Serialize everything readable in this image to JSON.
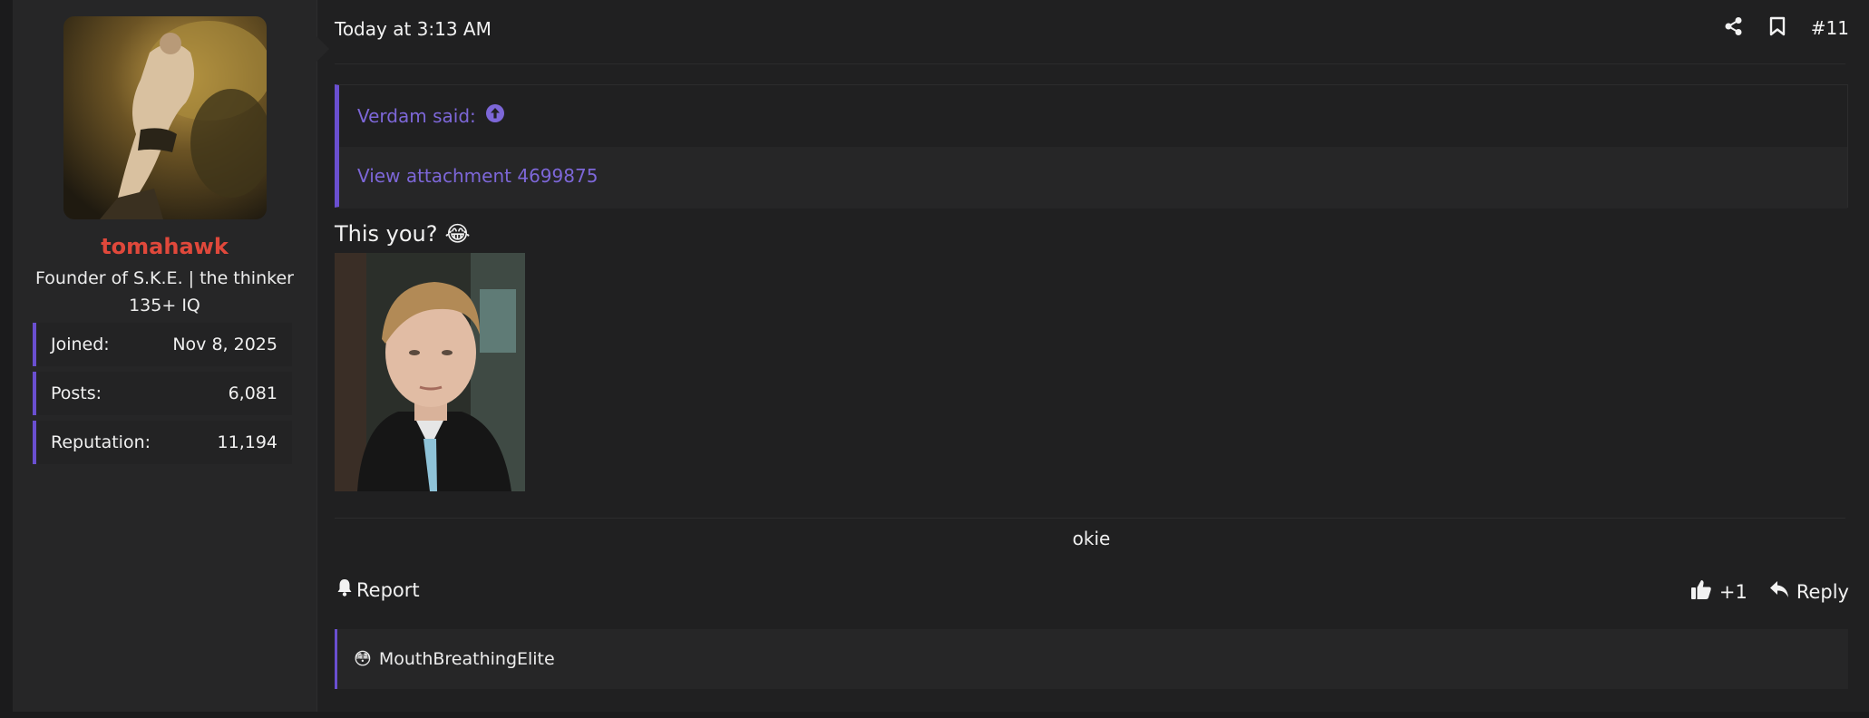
{
  "user": {
    "name": "tomahawk",
    "title_line1": "Founder of S.K.E. | the thinker",
    "title_line2": "135+ IQ",
    "stats": [
      {
        "label": "Joined:",
        "value": "Nov 8, 2025"
      },
      {
        "label": "Posts:",
        "value": "6,081"
      },
      {
        "label": "Reputation:",
        "value": "11,194"
      }
    ],
    "name_color": "#e0483b"
  },
  "post": {
    "date": "Today at 3:13 AM",
    "number": "#11",
    "quote": {
      "author_line": "Verdam said:",
      "attachment_link": "View attachment 4699875"
    },
    "message": "This you?",
    "message_emoji": "😂",
    "signature": "okie"
  },
  "actions": {
    "report": "Report",
    "like_count": "+1",
    "reply": "Reply"
  },
  "reactions": {
    "emoji": "😳",
    "users": "MouthBreathingElite"
  },
  "icons": [
    "share-icon",
    "bookmark-icon",
    "arrow-up-circle-icon",
    "bell-icon",
    "thumbs-up-icon",
    "reply-icon",
    "flushed-face-icon"
  ],
  "colors": {
    "accent": "#6a4fd0",
    "link": "#7d67d8",
    "background": "#202021"
  }
}
